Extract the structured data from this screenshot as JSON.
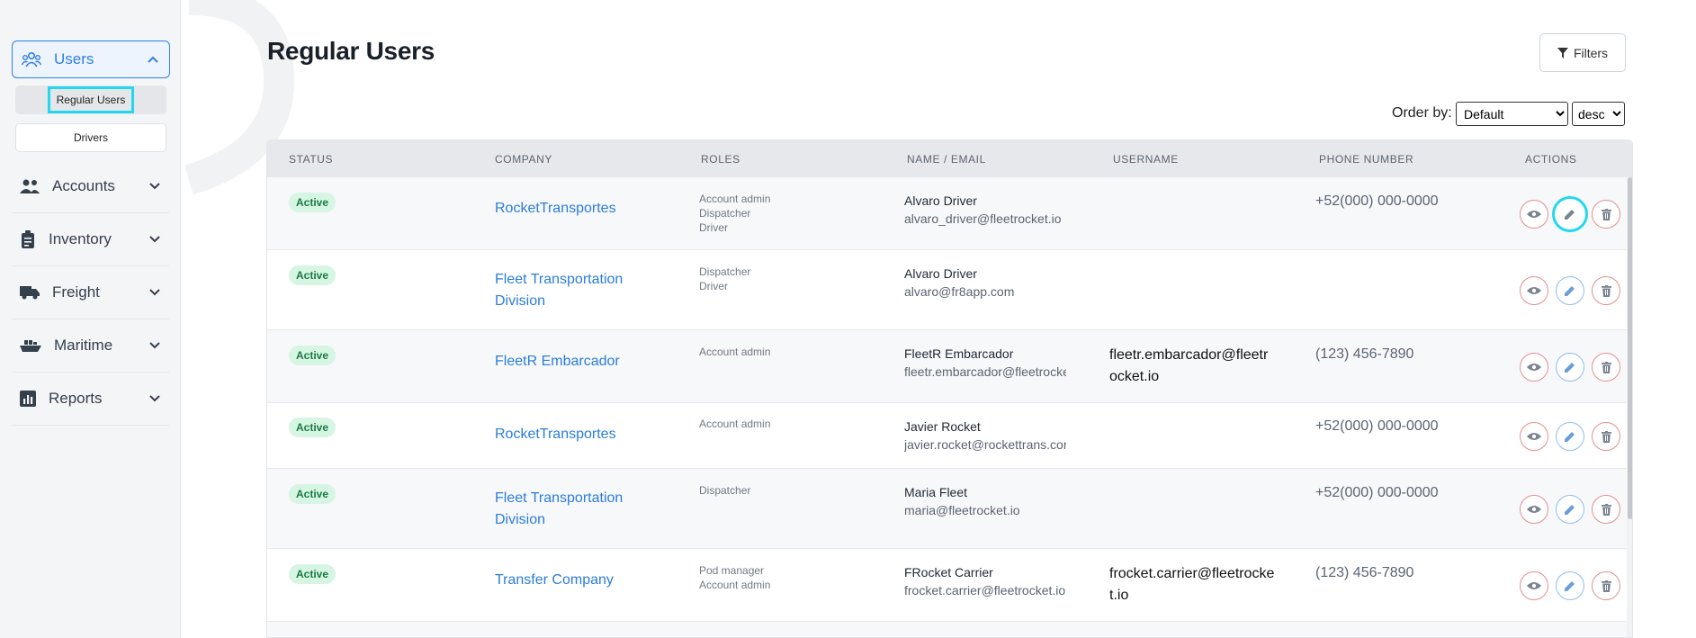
{
  "sidebar": {
    "users": {
      "label": "Users",
      "icon": "users-icon"
    },
    "subitems": [
      {
        "label": "Regular Users",
        "active": true
      },
      {
        "label": "Drivers",
        "active": false
      }
    ],
    "items": [
      {
        "label": "Accounts",
        "icon": "accounts-icon"
      },
      {
        "label": "Inventory",
        "icon": "clipboard-icon"
      },
      {
        "label": "Freight",
        "icon": "truck-icon"
      },
      {
        "label": "Maritime",
        "icon": "ship-icon"
      },
      {
        "label": "Reports",
        "icon": "chart-icon"
      }
    ]
  },
  "page": {
    "title": "Regular Users",
    "filters_label": "Filters",
    "order_label": "Order by:",
    "order_value": "Default",
    "direction_value": "desc"
  },
  "table": {
    "headers": [
      "STATUS",
      "COMPANY",
      "ROLES",
      "NAME / EMAIL",
      "USERNAME",
      "PHONE NUMBER",
      "ACTIONS"
    ],
    "rows": [
      {
        "status": "Active",
        "company": "RocketTransportes",
        "roles": [
          "Account admin",
          "Dispatcher",
          "Driver"
        ],
        "name": "Alvaro Driver",
        "email": "alvaro_driver@fleetrocket.io",
        "username": "",
        "phone": "+52(000) 000-0000"
      },
      {
        "status": "Active",
        "company": "Fleet Transportation Division",
        "roles": [
          "Dispatcher",
          "Driver"
        ],
        "name": "Alvaro Driver",
        "email": "alvaro@fr8app.com",
        "username": "",
        "phone": ""
      },
      {
        "status": "Active",
        "company": "FleetR Embarcador",
        "roles": [
          "Account admin"
        ],
        "name": "FleetR Embarcador",
        "email": "fleetr.embarcador@fleetrocke",
        "username": "fleetr.embarcador@fleetrocket.io",
        "phone": "(123) 456-7890"
      },
      {
        "status": "Active",
        "company": "RocketTransportes",
        "roles": [
          "Account admin"
        ],
        "name": "Javier Rocket",
        "email": "javier.rocket@rockettrans.cor",
        "username": "",
        "phone": "+52(000) 000-0000"
      },
      {
        "status": "Active",
        "company": "Fleet Transportation Division",
        "roles": [
          "Dispatcher"
        ],
        "name": "Maria Fleet",
        "email": "maria@fleetrocket.io",
        "username": "",
        "phone": "+52(000) 000-0000"
      },
      {
        "status": "Active",
        "company": "Transfer Company",
        "roles": [
          "Pod manager",
          "Account admin"
        ],
        "name": "FRocket Carrier",
        "email": "frocket.carrier@fleetrocket.io",
        "username": "frocket.carrier@fleetrocket.io",
        "phone": "(123) 456-7890"
      }
    ]
  },
  "colors": {
    "accent": "#2e7fe6",
    "highlight": "#23d8ee",
    "active_badge_bg": "#d6f5e3",
    "active_badge_text": "#1a7a44",
    "danger": "#e58e8e"
  }
}
